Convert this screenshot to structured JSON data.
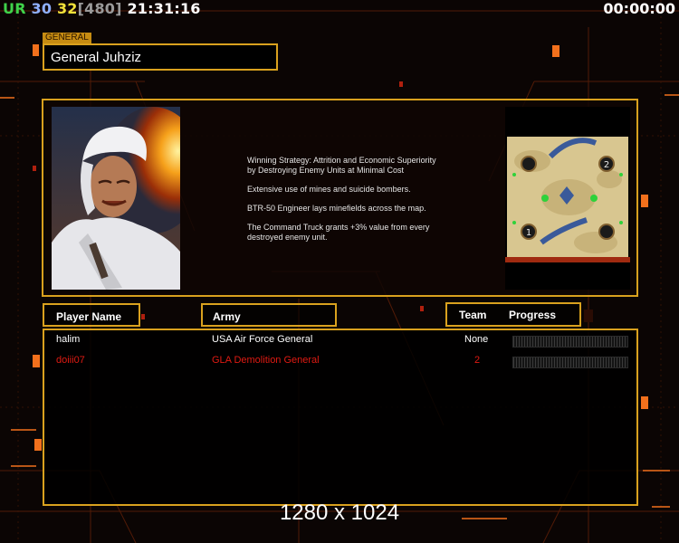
{
  "hud": {
    "ur_label": "UR",
    "stat_a": "30",
    "stat_b": "32",
    "bracket_value": "[480]",
    "clock": "21:31:16",
    "timer": "00:00:00"
  },
  "general": {
    "tag": "GENERAL",
    "name": "General Juhziz",
    "portrait_icon": "general-portrait",
    "description": [
      "Winning Strategy: Attrition and Economic Superiority\n by Destroying Enemy Units at Minimal Cost",
      "Extensive use of mines and suicide bombers.",
      "BTR-50 Engineer lays minefields across the map.",
      "The Command Truck grants +3% value from every\n destroyed enemy unit."
    ]
  },
  "minimap": {
    "start_positions": [
      "1",
      "2"
    ]
  },
  "table": {
    "headers": {
      "player": "Player Name",
      "army": "Army",
      "team": "Team",
      "progress": "Progress"
    },
    "rows": [
      {
        "player": "halim",
        "army": "USA Air Force General",
        "team": "None",
        "color": "#ffffff",
        "progress": 0
      },
      {
        "player": "doiii07",
        "army": "GLA Demolition General",
        "team": "2",
        "color": "#e01a12",
        "progress": 0
      }
    ]
  },
  "resolution": "1280 x 1024",
  "colors": {
    "accent_gold": "#d9a11e",
    "ur_green": "#3fd24a",
    "stat_blue": "#8fb0ff",
    "stat_yellow": "#f2e23a",
    "bracket_gray": "#9a9a9a",
    "enemy_red": "#e01a12"
  }
}
